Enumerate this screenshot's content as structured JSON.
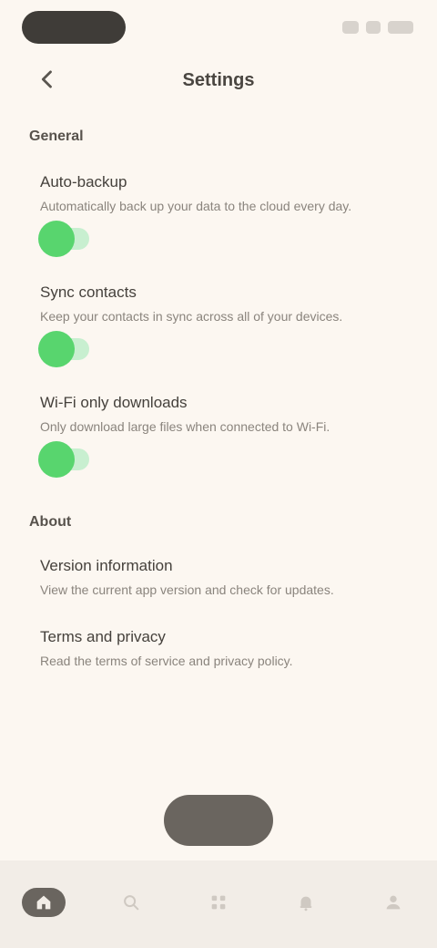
{
  "app_bar": {
    "title": "Settings"
  },
  "icons": {
    "back": "arrow-left-icon"
  },
  "colors": {
    "background": "#fcf7f1",
    "toggle_on": "#58d56e",
    "accent_dark": "#6a655f"
  },
  "sections": [
    {
      "header": "General",
      "settings": [
        {
          "title": "Auto-backup",
          "desc": "Automatically back up your data to the cloud every day.",
          "enabled": true
        },
        {
          "title": "Sync contacts",
          "desc": "Keep your contacts in sync across all of your devices.",
          "enabled": true
        },
        {
          "title": "Wi-Fi only downloads",
          "desc": "Only download large files when connected to Wi-Fi.",
          "enabled": true
        }
      ]
    },
    {
      "header": "About",
      "settings": [
        {
          "title": "Version information",
          "desc": "View the current app version and check for updates."
        },
        {
          "title": "Terms and privacy",
          "desc": "Read the terms of service and privacy policy."
        }
      ]
    }
  ],
  "floating_button": {
    "label": ""
  },
  "bottom_nav": [
    {
      "label": "",
      "icon": "home-icon",
      "active": true
    },
    {
      "label": "",
      "icon": "search-icon",
      "active": false
    },
    {
      "label": "",
      "icon": "grid-icon",
      "active": false
    },
    {
      "label": "",
      "icon": "bell-icon",
      "active": false
    },
    {
      "label": "",
      "icon": "person-icon",
      "active": false
    }
  ]
}
